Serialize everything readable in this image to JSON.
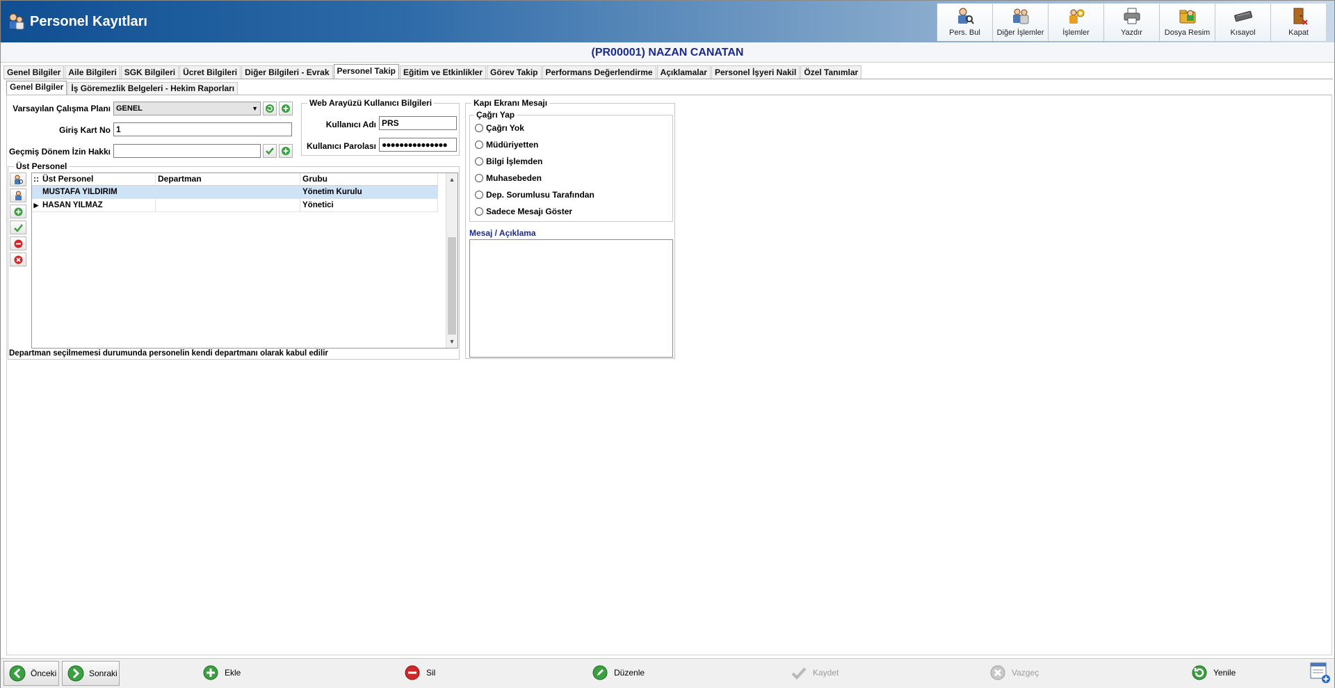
{
  "app": {
    "title": "Personel Kayıtları"
  },
  "toolbar": [
    {
      "label": "Pers. Bul",
      "icon": "person-search-icon"
    },
    {
      "label": "Diğer İşlemler",
      "icon": "people-icon"
    },
    {
      "label": "İşlemler",
      "icon": "gear-people-icon"
    },
    {
      "label": "Yazdır",
      "icon": "printer-icon"
    },
    {
      "label": "Dosya Resim",
      "icon": "folder-image-icon"
    },
    {
      "label": "Kısayol",
      "icon": "keyboard-icon"
    },
    {
      "label": "Kapat",
      "icon": "exit-door-icon"
    }
  ],
  "person": {
    "header": "(PR00001) NAZAN  CANATAN"
  },
  "tabs": [
    "Genel Bilgiler",
    "Aile Bilgileri",
    "SGK Bilgileri",
    "Ücret Bilgileri",
    "Diğer Bilgileri - Evrak",
    "Personel Takip",
    "Eğitim ve Etkinlikler",
    "Görev Takip",
    "Performans Değerlendirme",
    "Açıklamalar",
    "Personel İşyeri Nakil",
    "Özel Tanımlar"
  ],
  "active_tab": "Personel Takip",
  "subtabs": [
    "Genel Bilgiler",
    "İş Göremezlik Belgeleri - Hekim Raporları"
  ],
  "form": {
    "calisma_plani_label": "Varsayılan Çalışma Planı",
    "calisma_plani_value": "GENEL",
    "giris_kart_label": "Giriş Kart No",
    "giris_kart_value": "1",
    "gecmis_izin_label": "Geçmiş Dönem İzin Hakkı",
    "gecmis_izin_value": ""
  },
  "web": {
    "title": "Web Arayüzü Kullanıcı Bilgileri",
    "user_label": "Kullanıcı Adı",
    "user_value": "PRS",
    "pass_label": "Kullanıcı Parolası",
    "pass_value": "●●●●●●●●●●●●●●●"
  },
  "ust_personel": {
    "title": "Üst Personel",
    "columns": [
      "Üst Personel",
      "Departman",
      "Grubu"
    ],
    "rows": [
      {
        "name": "MUSTAFA YILDIRIM",
        "departman": "",
        "grubu": "Yönetim Kurulu"
      },
      {
        "name": "HASAN YILMAZ",
        "departman": "",
        "grubu": "Yönetici"
      }
    ],
    "note": "Departman seçilmemesi durumunda personelin kendi departmanı olarak kabul edilir"
  },
  "kapi": {
    "title": "Kapı Ekranı Mesajı",
    "cagri_title": "Çağrı Yap",
    "options": [
      "Çağrı Yok",
      "Müdüriyetten",
      "Bilgi İşlemden",
      "Muhasebeden",
      "Dep. Sorumlusu Tarafından",
      "Sadece Mesajı Göster"
    ],
    "mesaj_label": "Mesaj / Açıklama",
    "mesaj_value": ""
  },
  "bottom": {
    "prev": "Önceki",
    "next": "Sonraki",
    "add": "Ekle",
    "delete": "Sil",
    "edit": "Düzenle",
    "save": "Kaydet",
    "cancel": "Vazgeç",
    "refresh": "Yenile"
  },
  "colors": {
    "header_blue": "#0f4f92",
    "person_text": "#1a2a8a",
    "selected_row": "#cfe3f7",
    "mesaj_label": "#1a2a8a"
  }
}
